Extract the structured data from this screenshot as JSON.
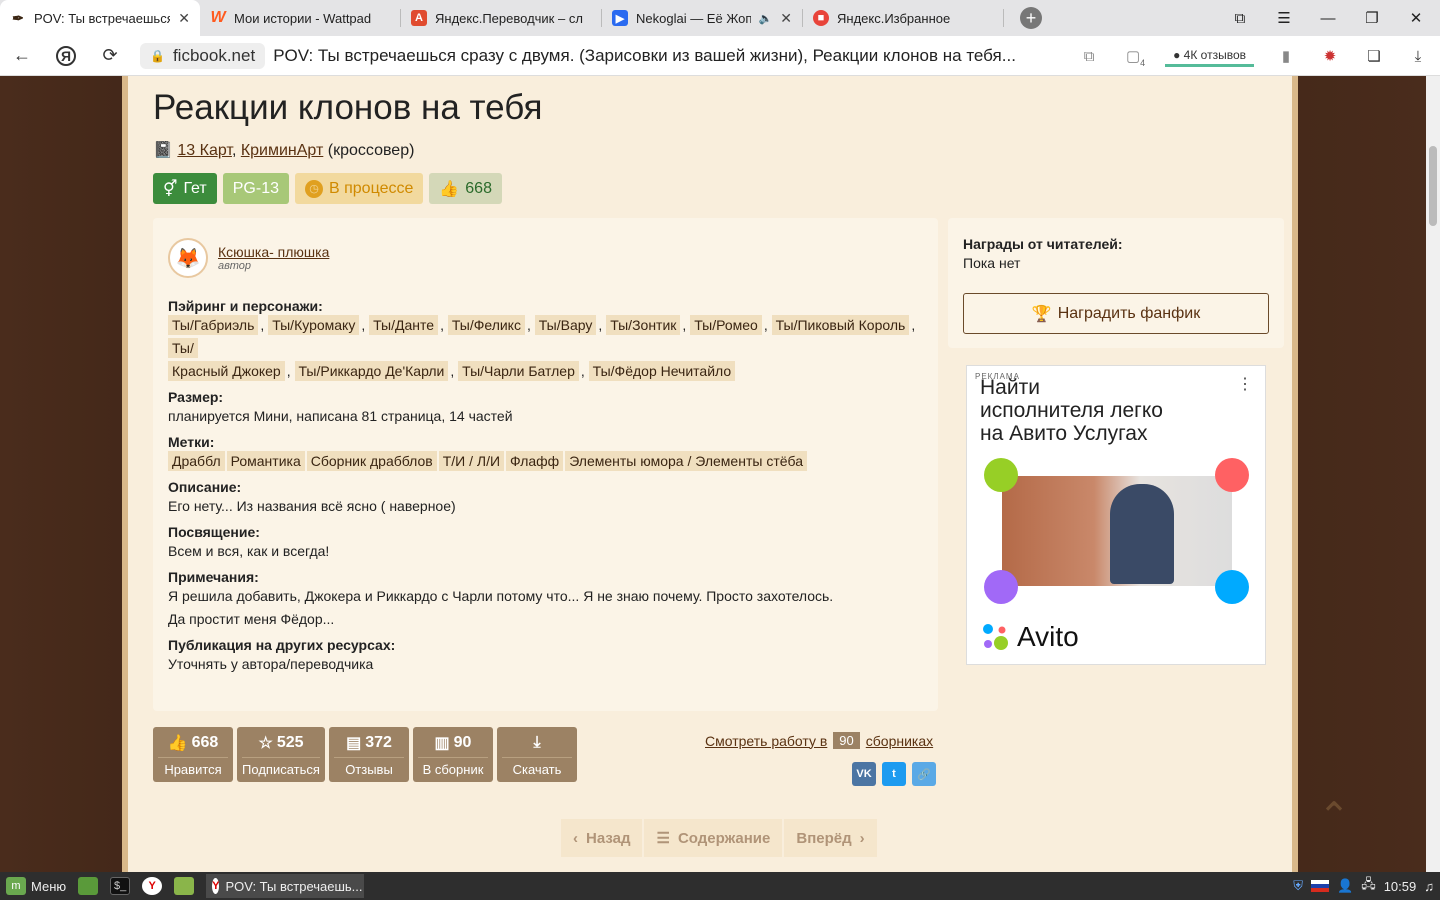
{
  "browser": {
    "tabs": [
      {
        "title": "POV: Ты встречаешься сразу",
        "favicon": "quill-icon",
        "color": "#ffffff",
        "active": true
      },
      {
        "title": "Мои истории - Wattpad",
        "favicon": "wattpad-icon",
        "color": "#ff5a1f"
      },
      {
        "title": "Яндекс.Переводчик – сл",
        "favicon": "translate-icon",
        "color": "#e04b2f"
      },
      {
        "title": "Nekoglai — Её Жопа",
        "favicon": "video-icon",
        "color": "#2a6af0"
      },
      {
        "title": "Яндекс.Избранное",
        "favicon": "bookmark-icon",
        "color": "#e8443a"
      }
    ],
    "domain": "ficbook.net",
    "page_title": "POV: Ты встречаешься сразу с двумя. (Зарисовки из вашей жизни), Реакции клонов на тебя...",
    "reviews_label": "4К отзывов",
    "tab_count": "4"
  },
  "work": {
    "chapter_title": "Реакции клонов на тебя",
    "fandoms": [
      "13 Карт",
      "КриминАрт"
    ],
    "crossover": "(кроссовер)",
    "direction": "Гет",
    "rating": "PG-13",
    "status": "В процессе",
    "likes": "668"
  },
  "author": {
    "name": "Ксюшка- плюшка",
    "role": "автор"
  },
  "info": {
    "pairing_label": "Пэйринг и персонажи:",
    "pairings_line1": [
      "Ты/Габриэль",
      "Ты/Куромаку",
      "Ты/Данте",
      "Ты/Феликс",
      "Ты/Вару",
      "Ты/Зонтик",
      "Ты/Ромео",
      "Ты/Пиковый Король",
      "Ты/"
    ],
    "pairings_line2": [
      "Красный Джокер",
      "Ты/Риккардо Де'Карли",
      "Ты/Чарли Батлер",
      "Ты/Фёдор Нечитайло"
    ],
    "size_label": "Размер:",
    "size_value": "планируется Мини, написана 81 страница, 14 частей",
    "tags_label": "Метки:",
    "tags": [
      "Драббл",
      "Романтика",
      "Сборник драбблов",
      "Т/И / Л/И",
      "Флафф",
      "Элементы юмора / Элементы стёба"
    ],
    "desc_label": "Описание:",
    "desc_value": "Его нету... Из названия всё ясно ( наверное)",
    "dedication_label": "Посвящение:",
    "dedication_value": "Всем и вся, как и всегда!",
    "notes_label": "Примечания:",
    "notes_line1": "Я решила добавить, Джокера и Риккардо с Чарли потому что... Я не знаю почему. Просто захотелось.",
    "notes_line2": "Да простит меня Фёдор...",
    "publication_label": "Публикация на других ресурсах:",
    "publication_value": "Уточнять у автора/переводчика"
  },
  "sidebar": {
    "awards_label": "Награды от читателей:",
    "awards_value": "Пока нет",
    "award_button": "Наградить фанфик"
  },
  "ad": {
    "label": "РЕКЛАМА",
    "headline_l1": "Найти",
    "headline_l2": "исполнителя легко",
    "headline_l3": "на Авито Услугах",
    "brand": "Avito",
    "colors": [
      "#97cf26",
      "#ff6163",
      "#a169f7",
      "#00aaff"
    ]
  },
  "stats": [
    {
      "num": "668",
      "cap": "Нравится",
      "icon": "thumbs-up-icon"
    },
    {
      "num": "525",
      "cap": "Подписаться",
      "icon": "star-icon"
    },
    {
      "num": "372",
      "cap": "Отзывы",
      "icon": "comment-icon"
    },
    {
      "num": "90",
      "cap": "В сборник",
      "icon": "book-icon"
    },
    {
      "num": "",
      "cap": "Скачать",
      "icon": "download-icon"
    }
  ],
  "collections": {
    "pre": "Смотреть работу в",
    "count": "90",
    "post": "сборниках"
  },
  "share": [
    {
      "label": "VK",
      "color": "#4c75a3"
    },
    {
      "label": "t",
      "color": "#1d9bf0"
    },
    {
      "label": "🔗",
      "color": "#5aa9e6"
    }
  ],
  "pager": {
    "back": "Назад",
    "contents": "Содержание",
    "forward": "Вперёд"
  },
  "taskbar": {
    "menu": "Меню",
    "window_title": "POV: Ты встречаешь...",
    "clock": "10:59"
  }
}
